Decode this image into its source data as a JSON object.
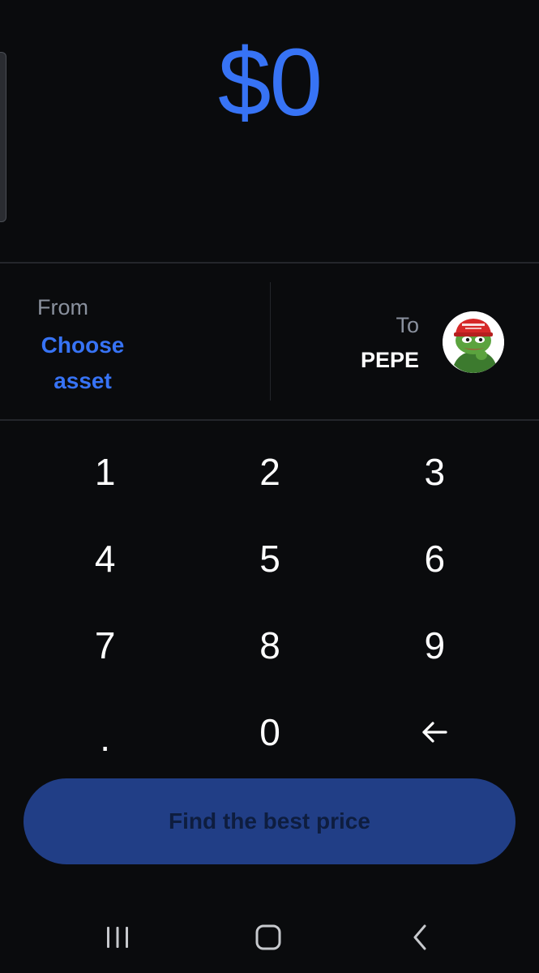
{
  "amount": {
    "display": "$0"
  },
  "from": {
    "label": "From",
    "asset_line1": "Choose",
    "asset_line2": "asset"
  },
  "to": {
    "label": "To",
    "asset": "PEPE",
    "avatar_icon": "pepe-token-icon"
  },
  "keypad": {
    "keys": [
      "1",
      "2",
      "3",
      "4",
      "5",
      "6",
      "7",
      "8",
      "9",
      ".",
      "0"
    ],
    "backspace_icon": "backspace-arrow-icon"
  },
  "cta": {
    "label": "Find the best price"
  },
  "system_nav": {
    "recents_icon": "recent-apps-icon",
    "home_icon": "home-icon",
    "back_icon": "back-icon"
  },
  "colors": {
    "background": "#0a0b0d",
    "accent": "#3773f5",
    "muted_text": "#8a919e",
    "cta_disabled": "#213e86"
  }
}
